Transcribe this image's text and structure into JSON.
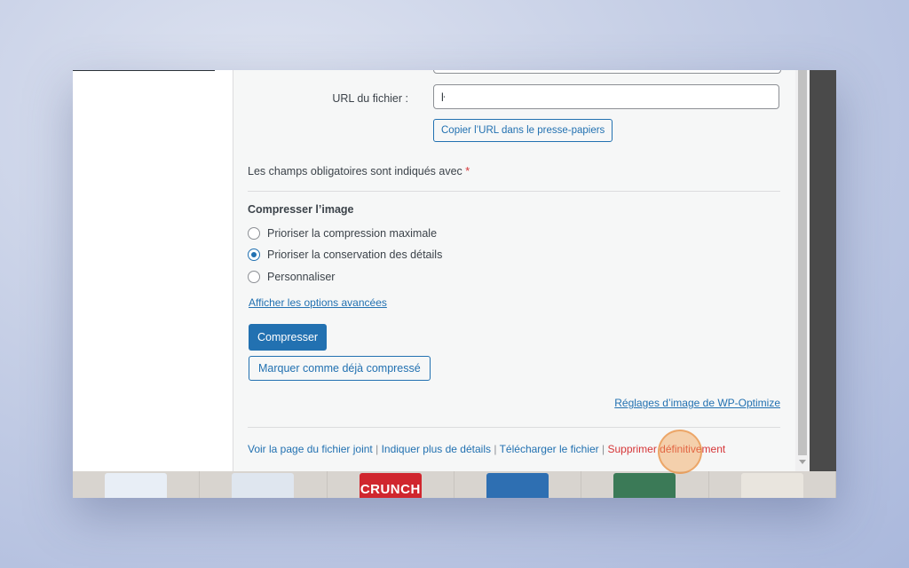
{
  "form": {
    "url_label": "URL du fichier :",
    "url_value": "ŀ",
    "copy_url_button": "Copier l’URL dans le presse-papiers",
    "required_note": "Les champs obligatoires sont indiqués avec",
    "required_star": "*"
  },
  "compress": {
    "title": "Compresser l’image",
    "options": [
      {
        "label": "Prioriser la compression maximale",
        "checked": false
      },
      {
        "label": "Prioriser la conservation des détails",
        "checked": true
      },
      {
        "label": "Personnaliser",
        "checked": false
      }
    ],
    "advanced_link": "Afficher les options avancées",
    "compress_button": "Compresser",
    "mark_button": "Marquer comme déjà compressé",
    "settings_link": "Réglages d’image de WP-Optimize"
  },
  "actions": {
    "view_page": "Voir la page du fichier joint",
    "more_details": "Indiquer plus de détails",
    "download": "Télécharger le fichier",
    "delete": "Supprimer définitivement",
    "separator": "|"
  },
  "background_products": [
    {
      "label": "",
      "color": "#e8eef6"
    },
    {
      "label": "",
      "color": "#dfe6ef"
    },
    {
      "label": "CRUNCH",
      "color": "#d0262e"
    },
    {
      "label": "",
      "color": "#2e6fb2"
    },
    {
      "label": "",
      "color": "#3b7a57"
    },
    {
      "label": "",
      "color": "#e9e5de"
    }
  ],
  "colors": {
    "accent": "#2271b1",
    "danger": "#d63638",
    "click_highlight": "#f2a050"
  }
}
